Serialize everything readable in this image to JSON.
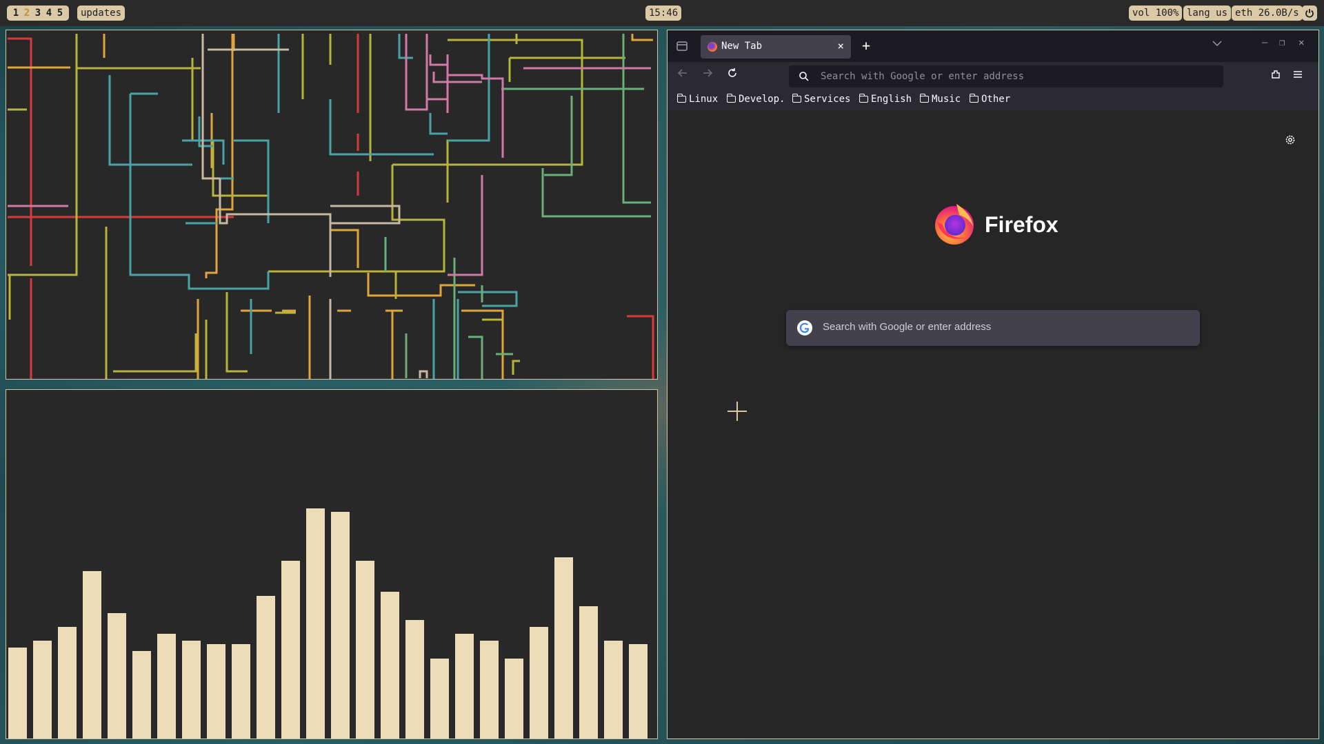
{
  "topbar": {
    "workspaces": [
      "1",
      "2",
      "3",
      "4",
      "5"
    ],
    "active_workspace": "2",
    "updates_label": "updates",
    "clock": "15:46",
    "volume": "vol 100%",
    "language": "lang us",
    "network": "eth 26.0B/s"
  },
  "visualizer": {
    "bar_color": "#ecdcb8",
    "levels": [
      0.26,
      0.28,
      0.32,
      0.48,
      0.36,
      0.25,
      0.3,
      0.28,
      0.27,
      0.27,
      0.41,
      0.51,
      0.66,
      0.65,
      0.51,
      0.42,
      0.34,
      0.23,
      0.3,
      0.28,
      0.23,
      0.32,
      0.52,
      0.38,
      0.28,
      0.27
    ]
  },
  "firefox": {
    "tab_title": "New Tab",
    "urlbar_placeholder": "Search with Google or enter address",
    "bookmarks": [
      "Linux",
      "Develop.",
      "Services",
      "English",
      "Music",
      "Other"
    ],
    "brand": "Firefox",
    "search_placeholder": "Search with Google or enter address"
  },
  "colors": {
    "bar_bg": "#2a2a2a",
    "pill_bg": "#d9c9a6",
    "active_ws": "#c98b2b",
    "window_border": "#cfc6a8",
    "firefox_accent": "#ff7139"
  }
}
